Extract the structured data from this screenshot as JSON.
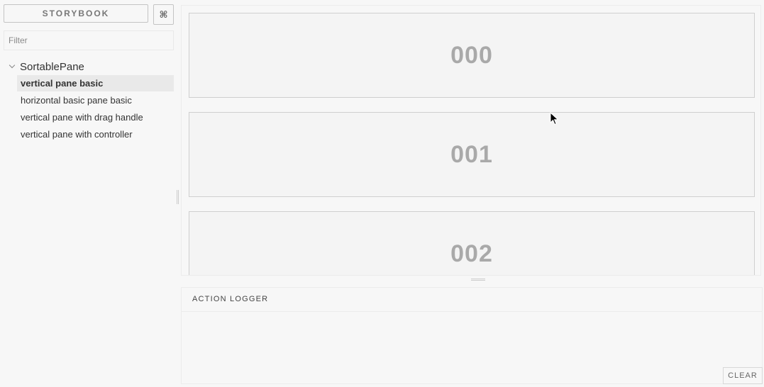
{
  "sidebar": {
    "brand_label": "STORYBOOK",
    "shortcut_icon": "⌘",
    "filter_placeholder": "Filter",
    "kind": {
      "label": "SortablePane",
      "expanded": true
    },
    "stories": [
      {
        "label": "vertical pane basic",
        "selected": true
      },
      {
        "label": "horizontal basic pane basic",
        "selected": false
      },
      {
        "label": "vertical pane with drag handle",
        "selected": false
      },
      {
        "label": "vertical pane with controller",
        "selected": false
      }
    ]
  },
  "preview": {
    "panes": [
      {
        "label": "000"
      },
      {
        "label": "001"
      },
      {
        "label": "002"
      }
    ]
  },
  "addon_panel": {
    "tab_label": "ACTION LOGGER",
    "clear_label": "CLEAR"
  },
  "colors": {
    "background": "#f7f7f7",
    "pane_border": "#cfcfcf",
    "pane_text": "#a9a9a9",
    "selected_row": "#e9e9e9"
  }
}
